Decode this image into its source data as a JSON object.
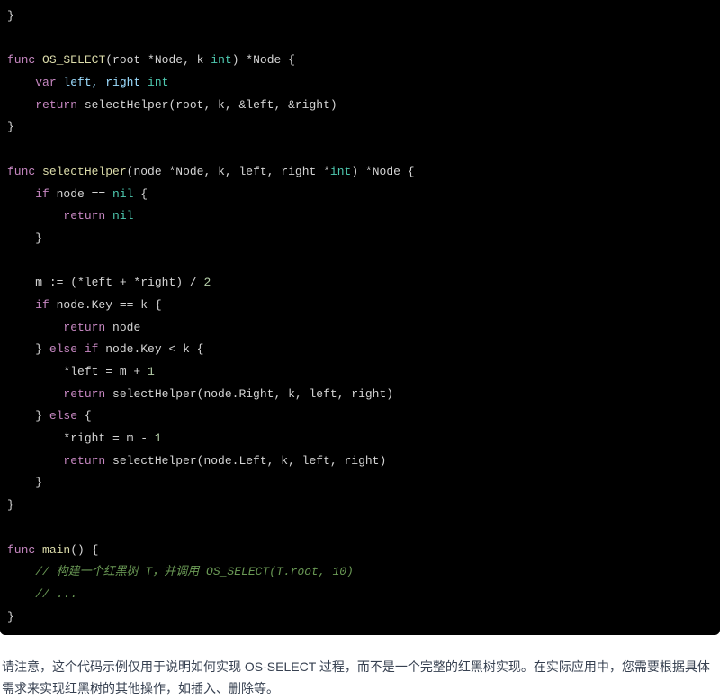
{
  "code": {
    "l01": "}",
    "l02_func": "func",
    "l02_name": "OS_SELECT",
    "l02_p1": "(root *Node, k ",
    "l02_int": "int",
    "l02_p2": ") *Node {",
    "l03_var": "var",
    "l03_rest": " left, right ",
    "l03_int": "int",
    "l04_ret": "return",
    "l04_rest": " selectHelper(root, k, &left, &right)",
    "l05": "}",
    "l06_func": "func",
    "l06_name": "selectHelper",
    "l06_p1": "(node *Node, k, left, right *",
    "l06_int": "int",
    "l06_p2": ") *Node {",
    "l07_if": "if",
    "l07_rest": " node == ",
    "l07_nil": "nil",
    "l07_brace": " {",
    "l08_ret": "return",
    "l08_nil": " nil",
    "l09": "}",
    "l10_a": "m := (*left + *right) / ",
    "l10_num": "2",
    "l11_if": "if",
    "l11_rest": " node.Key == k {",
    "l12_ret": "return",
    "l12_rest": " node",
    "l13_a": "} ",
    "l13_else": "else",
    "l13_if": " if",
    "l13_rest": " node.Key < k {",
    "l14": "*left = m + ",
    "l14_num": "1",
    "l15_ret": "return",
    "l15_rest": " selectHelper(node.Right, k, left, right)",
    "l16_a": "} ",
    "l16_else": "else",
    "l16_brace": " {",
    "l17": "*right = m - ",
    "l17_num": "1",
    "l18_ret": "return",
    "l18_rest": " selectHelper(node.Left, k, left, right)",
    "l19": "}",
    "l20": "}",
    "l21_func": "func",
    "l21_name": "main",
    "l21_rest": "() {",
    "l22": "// 构建一个红黑树 T，并调用 OS_SELECT(T.root, 10)",
    "l23": "// ...",
    "l24": "}"
  },
  "paragraph": "请注意，这个代码示例仅用于说明如何实现 OS-SELECT 过程，而不是一个完整的红黑树实现。在实际应用中，您需要根据具体需求来实现红黑树的其他操作，如插入、删除等。"
}
